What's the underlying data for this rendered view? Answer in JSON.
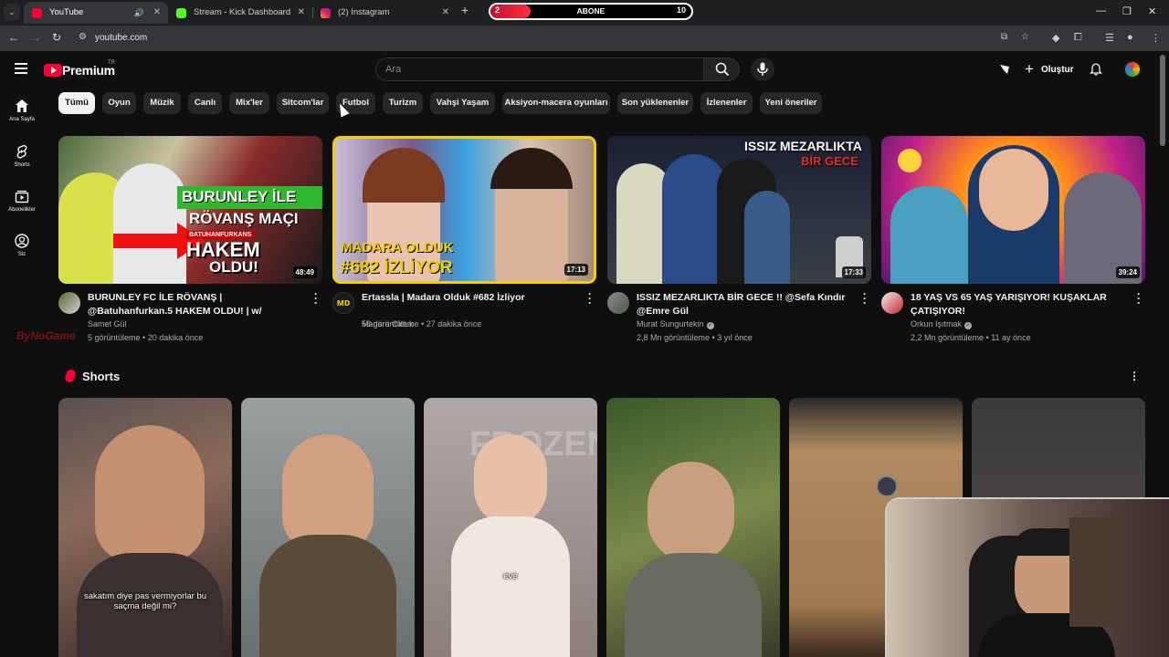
{
  "browser": {
    "tabs": [
      {
        "title": "YouTube",
        "favicon": "youtube-icon",
        "active": true
      },
      {
        "title": "Stream - Kick Dashboard",
        "favicon": "kick-icon",
        "active": false
      },
      {
        "title": "(2) Instagram",
        "favicon": "instagram-icon",
        "active": false
      }
    ],
    "subscriber_goal": {
      "current": "2",
      "label": "ABONE",
      "goal": "10",
      "progress": 0.2
    },
    "url": "youtube.com"
  },
  "youtube": {
    "logo_text": "Premium",
    "logo_region": "TR",
    "search_placeholder": "Ara",
    "create_label": "Oluştur",
    "sidebar": [
      {
        "label": "Ana Sayfa",
        "icon": "home-icon"
      },
      {
        "label": "Shorts",
        "icon": "shorts-icon"
      },
      {
        "label": "Abonelikler",
        "icon": "subscriptions-icon"
      },
      {
        "label": "Siz",
        "icon": "you-icon"
      }
    ],
    "chips": [
      "Tümü",
      "Oyun",
      "Müzik",
      "Canlı",
      "Mix'ler",
      "Sitcom'lar",
      "Futbol",
      "Turizm",
      "Vahşi Yaşam",
      "Aksiyon-macera oyunları",
      "Son yüklenenler",
      "İzlenenler",
      "Yeni öneriler"
    ],
    "videos": [
      {
        "title": "BURUNLEY FC İLE RÖVANŞ | @Batuhanfurkan.5 HAKEM OLDU! | w/ @kontravoltaTV @TolunayOr...",
        "channel": "Samet Gül",
        "verified": false,
        "views": "5 görüntüleme",
        "age": "20 dakika önce",
        "duration": "48:49",
        "thumb_text": [
          "BURUNLEY İLE",
          "RÖVANŞ MAÇI",
          "BATUHANFURKANS",
          "HAKEM",
          "OLDU!"
        ]
      },
      {
        "title": "Ertassla | Madara Olduk #682 İzliyor",
        "channel": "Madara Olduk",
        "verified": false,
        "views": "58 görüntüleme",
        "age": "27 dakika önce",
        "duration": "17:13",
        "thumb_text": [
          "MADARA OLDUK",
          "#682 İZLİYOR"
        ]
      },
      {
        "title": "ISSIZ MEZARLIKTA BİR GECE !! @Sefa Kındır @Emre Gül",
        "channel": "Murat Sungurtekin",
        "verified": true,
        "views": "2,8 Mn görüntüleme",
        "age": "3 yıl önce",
        "duration": "17:33",
        "thumb_text": [
          "ISSIZ MEZARLIKTA",
          "BİR GECE"
        ]
      },
      {
        "title": "18 YAŞ VS 65 YAŞ YARIŞIYOR! KUŞAKLAR ÇATIŞIYOR!",
        "channel": "Orkun Işıtmak",
        "verified": true,
        "views": "2,2 Mn görüntüleme",
        "age": "11 ay önce",
        "duration": "39:24",
        "thumb_text": []
      }
    ],
    "watermark": "ByNoGame",
    "shorts_title": "Shorts",
    "shorts": [
      {
        "caption": "sakatım diye pas vermiyorlar bu saçma değil mi?"
      },
      {
        "caption": ""
      },
      {
        "caption": "eve",
        "sign": "FROZEN"
      },
      {
        "caption": ""
      },
      {
        "caption": ""
      },
      {
        "caption": ""
      }
    ]
  }
}
